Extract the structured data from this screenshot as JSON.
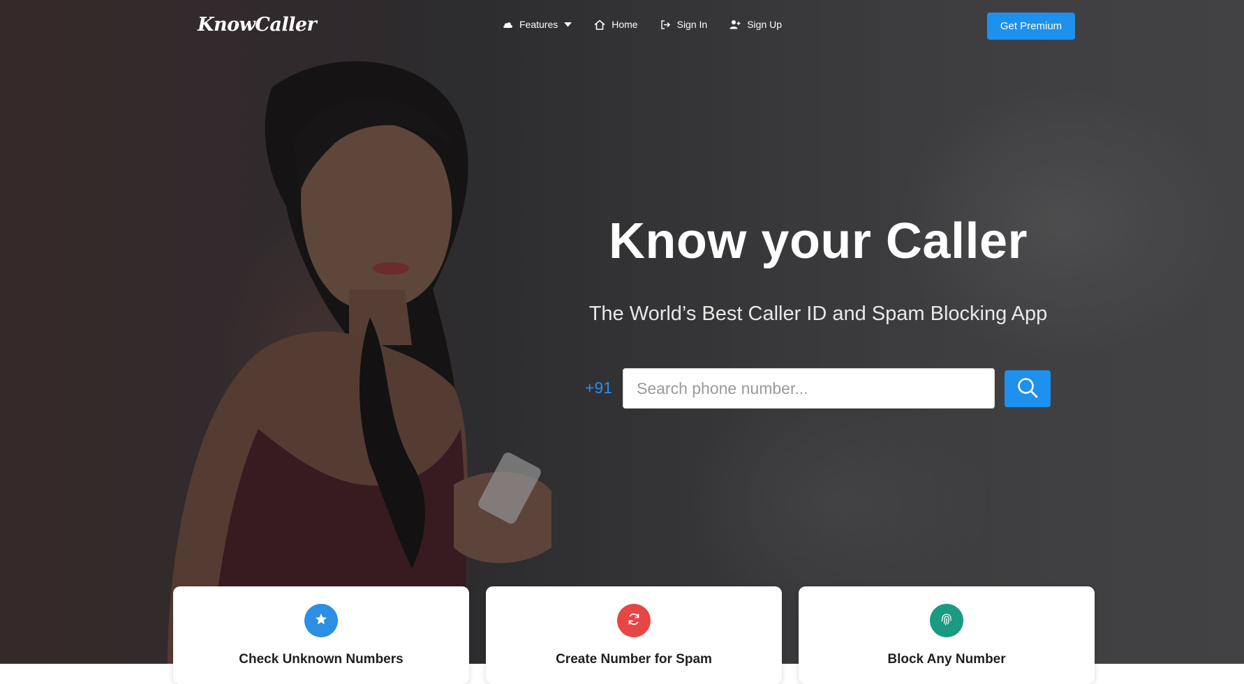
{
  "brand": {
    "logo_text": "KnowCaller"
  },
  "nav": {
    "items": [
      {
        "label": "Features",
        "icon": "cloud-upload-icon",
        "has_dropdown": true
      },
      {
        "label": "Home",
        "icon": "home-icon"
      },
      {
        "label": "Sign In",
        "icon": "sign-in-icon"
      },
      {
        "label": "Sign Up",
        "icon": "user-plus-icon"
      }
    ],
    "premium_label": "Get Premium"
  },
  "hero": {
    "title": "Know your Caller",
    "subtitle": "The World’s Best Caller ID and Spam Blocking App",
    "country_code": "+91",
    "search_placeholder": "Search phone number...",
    "search_value": ""
  },
  "features": [
    {
      "title": "Check Unknown Numbers",
      "icon": "star-icon",
      "color": "#2d8fe3"
    },
    {
      "title": "Create Number for Spam",
      "icon": "refresh-icon",
      "color": "#e84545"
    },
    {
      "title": "Block Any Number",
      "icon": "fingerprint-icon",
      "color": "#1a9a80"
    }
  ],
  "colors": {
    "accent": "#1e90ee",
    "country_code": "#2b8fe9"
  }
}
